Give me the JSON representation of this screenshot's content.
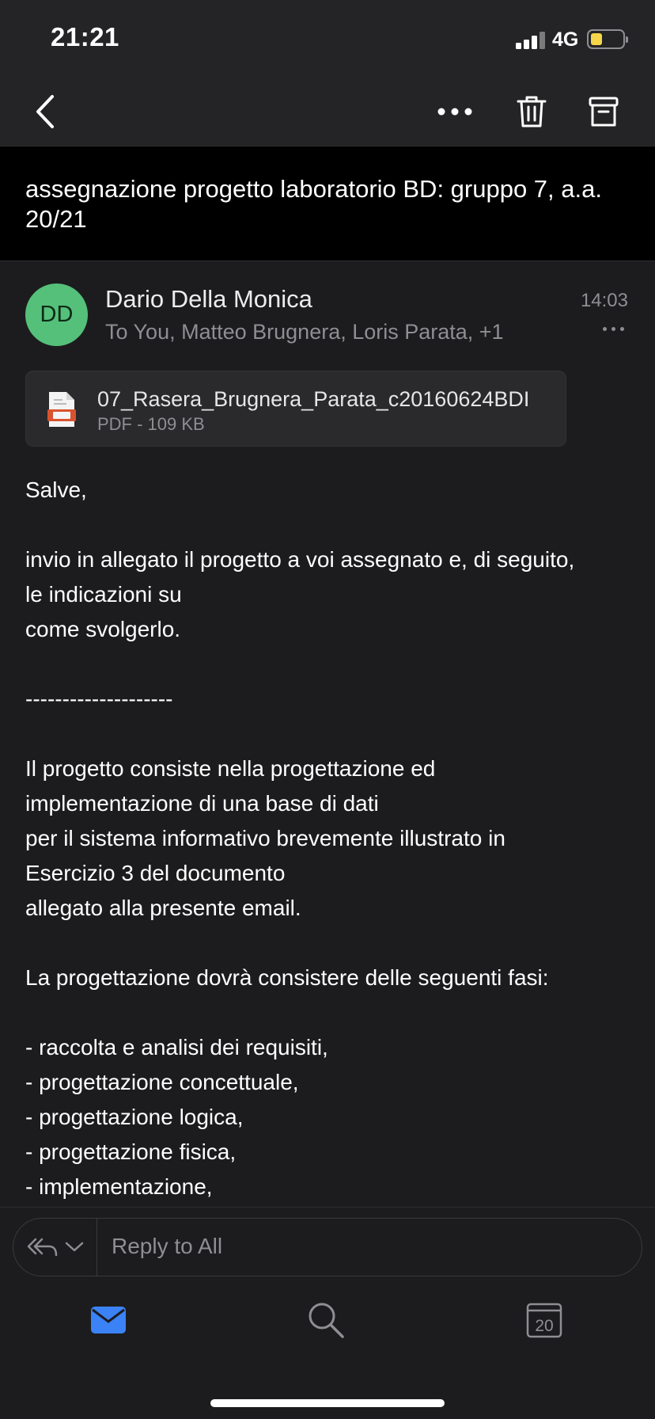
{
  "status": {
    "time": "21:21",
    "network": "4G",
    "battery_color": "#f5d54a"
  },
  "nav": {
    "back_icon": "chevron-left-icon",
    "more_icon": "more-horizontal-icon",
    "delete_icon": "trash-icon",
    "archive_icon": "archive-icon"
  },
  "email": {
    "subject": "assegnazione progetto laboratorio BD: gruppo 7, a.a. 20/21",
    "sender": {
      "initials": "DD",
      "name": "Dario Della Monica",
      "recipients": "To You, Matteo Brugnera, Loris Parata, +1",
      "time": "14:03",
      "avatar_color": "#55c07a"
    },
    "attachment": {
      "name": "07_Rasera_Brugnera_Parata_c20160624BDI",
      "meta": "PDF - 109 KB"
    },
    "body_lines": [
      "Salve,",
      "",
      "invio in allegato il progetto a voi assegnato e, di seguito,",
      "le indicazioni su",
      "come svolgerlo.",
      "",
      "--------------------",
      "",
      "Il progetto consiste nella progettazione ed",
      "implementazione di una base di dati",
      "per il sistema informativo brevemente illustrato in",
      "Esercizio 3 del documento",
      "allegato alla presente email.",
      "",
      "La progettazione dovrà consistere delle seguenti fasi:",
      "",
      "- raccolta e analisi dei requisiti,",
      "- progettazione concettuale,",
      "- progettazione logica,",
      "- progettazione fisica,",
      "- implementazione,"
    ]
  },
  "reply": {
    "placeholder": "Reply to All"
  },
  "tabbar": {
    "mail_icon": "mail-icon",
    "search_icon": "search-icon",
    "calendar_date": "20",
    "accent": "#3b82f6"
  }
}
